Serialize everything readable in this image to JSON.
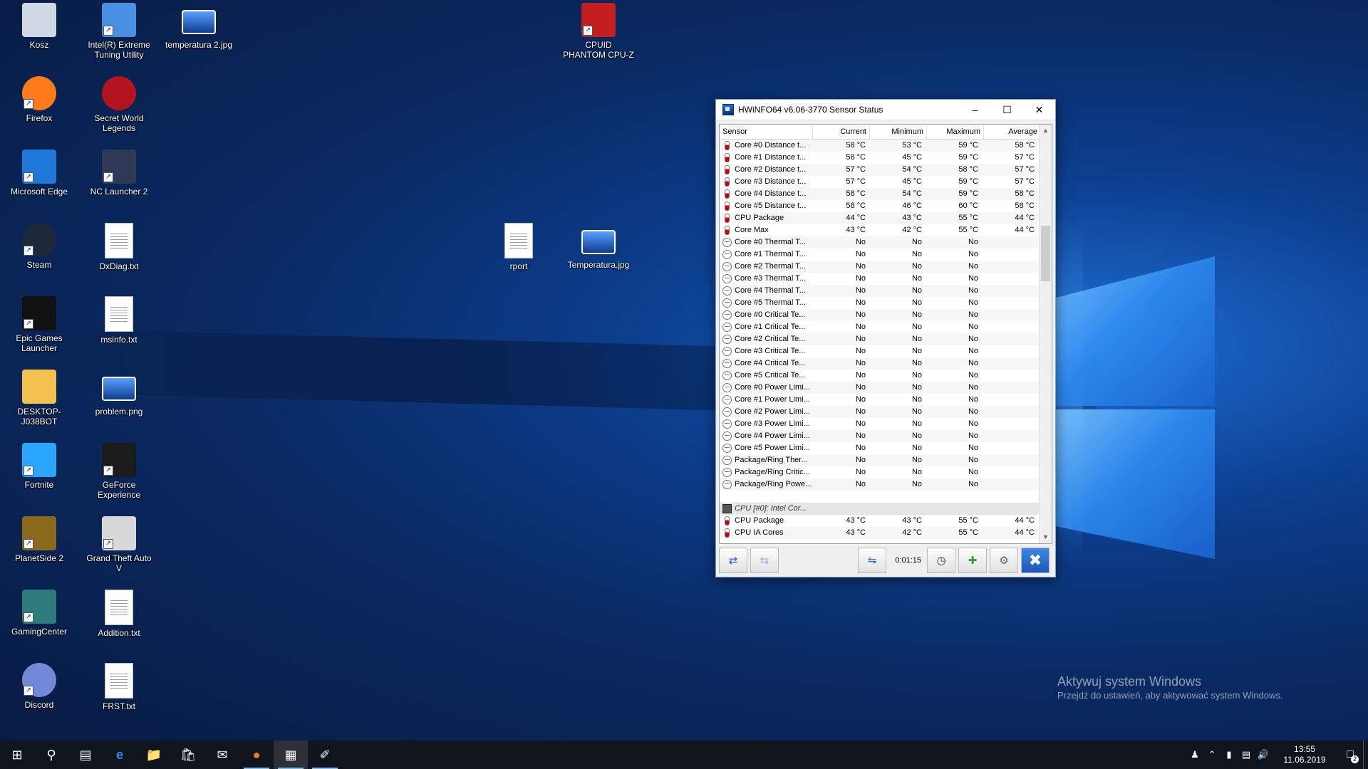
{
  "desktop": {
    "icons": [
      {
        "label": "Kosz",
        "icon": "recycle-bin-icon",
        "color": "#cfd8e3"
      },
      {
        "label": "Intel(R) Extreme Tuning Utility",
        "icon": "intel-xtu-icon",
        "color": "#4a90e2"
      },
      {
        "label": "temperatura 2.jpg",
        "icon": "image-file-icon",
        "color": "#2f7bd8"
      },
      {
        "label": "CPUID PHANTOM CPU-Z",
        "icon": "cpuz-icon",
        "color": "#c41f1f"
      },
      {
        "label": "Firefox",
        "icon": "firefox-icon",
        "color": "#ff7a1a"
      },
      {
        "label": "Secret World Legends",
        "icon": "secret-world-icon",
        "color": "#b3131f"
      },
      {
        "label": "Microsoft Edge",
        "icon": "edge-icon",
        "color": "#1e78d7"
      },
      {
        "label": "NC Launcher 2",
        "icon": "nc-launcher-icon",
        "color": "#2e3a55"
      },
      {
        "label": "Steam",
        "icon": "steam-icon",
        "color": "#1b2838"
      },
      {
        "label": "DxDiag.txt",
        "icon": "text-file-icon",
        "color": "#ffffff"
      },
      {
        "label": "rport",
        "icon": "file-icon",
        "color": "#ffffff"
      },
      {
        "label": "Temperatura.jpg",
        "icon": "image-file-icon",
        "color": "#2f7bd8"
      },
      {
        "label": "Epic Games Launcher",
        "icon": "epic-games-icon",
        "color": "#111111"
      },
      {
        "label": "msinfo.txt",
        "icon": "text-file-icon",
        "color": "#ffffff"
      },
      {
        "label": "DESKTOP-J038BOT",
        "icon": "folder-icon",
        "color": "#f2c14e"
      },
      {
        "label": "problem.png",
        "icon": "image-file-icon",
        "color": "#2f7bd8"
      },
      {
        "label": "Fortnite",
        "icon": "fortnite-icon",
        "color": "#2aa6ff"
      },
      {
        "label": "GeForce Experience",
        "icon": "geforce-icon",
        "color": "#1b1b1b"
      },
      {
        "label": "PlanetSide 2",
        "icon": "planetside-icon",
        "color": "#8a6a1a"
      },
      {
        "label": "Grand Theft Auto V",
        "icon": "gta-icon",
        "color": "#d8d8d8"
      },
      {
        "label": "GamingCenter",
        "icon": "gaming-center-icon",
        "color": "#2d7b7b"
      },
      {
        "label": "Addition.txt",
        "icon": "text-file-icon",
        "color": "#ffffff"
      },
      {
        "label": "Discord",
        "icon": "discord-icon",
        "color": "#7289da"
      },
      {
        "label": "FRST.txt",
        "icon": "text-file-icon",
        "color": "#ffffff"
      }
    ]
  },
  "hwinfo": {
    "title": "HWiNFO64 v6.06-3770 Sensor Status",
    "columns": [
      "Sensor",
      "Current",
      "Minimum",
      "Maximum",
      "Average"
    ],
    "rows": [
      {
        "type": "temp",
        "sensor": "Core #0 Distance t...",
        "current": "58 °C",
        "minimum": "53 °C",
        "maximum": "59 °C",
        "average": "58 °C"
      },
      {
        "type": "temp",
        "sensor": "Core #1 Distance t...",
        "current": "58 °C",
        "minimum": "45 °C",
        "maximum": "59 °C",
        "average": "57 °C"
      },
      {
        "type": "temp",
        "sensor": "Core #2 Distance t...",
        "current": "57 °C",
        "minimum": "54 °C",
        "maximum": "58 °C",
        "average": "57 °C"
      },
      {
        "type": "temp",
        "sensor": "Core #3 Distance t...",
        "current": "57 °C",
        "minimum": "45 °C",
        "maximum": "59 °C",
        "average": "57 °C"
      },
      {
        "type": "temp",
        "sensor": "Core #4 Distance t...",
        "current": "58 °C",
        "minimum": "54 °C",
        "maximum": "59 °C",
        "average": "58 °C"
      },
      {
        "type": "temp",
        "sensor": "Core #5 Distance t...",
        "current": "58 °C",
        "minimum": "46 °C",
        "maximum": "60 °C",
        "average": "58 °C"
      },
      {
        "type": "temp",
        "sensor": "CPU Package",
        "current": "44 °C",
        "minimum": "43 °C",
        "maximum": "55 °C",
        "average": "44 °C"
      },
      {
        "type": "temp",
        "sensor": "Core Max",
        "current": "43 °C",
        "minimum": "42 °C",
        "maximum": "55 °C",
        "average": "44 °C"
      },
      {
        "type": "flag",
        "sensor": "Core #0 Thermal T...",
        "current": "No",
        "minimum": "No",
        "maximum": "No",
        "average": ""
      },
      {
        "type": "flag",
        "sensor": "Core #1 Thermal T...",
        "current": "No",
        "minimum": "No",
        "maximum": "No",
        "average": ""
      },
      {
        "type": "flag",
        "sensor": "Core #2 Thermal T...",
        "current": "No",
        "minimum": "No",
        "maximum": "No",
        "average": ""
      },
      {
        "type": "flag",
        "sensor": "Core #3 Thermal T...",
        "current": "No",
        "minimum": "No",
        "maximum": "No",
        "average": ""
      },
      {
        "type": "flag",
        "sensor": "Core #4 Thermal T...",
        "current": "No",
        "minimum": "No",
        "maximum": "No",
        "average": ""
      },
      {
        "type": "flag",
        "sensor": "Core #5 Thermal T...",
        "current": "No",
        "minimum": "No",
        "maximum": "No",
        "average": ""
      },
      {
        "type": "flag",
        "sensor": "Core #0 Critical Te...",
        "current": "No",
        "minimum": "No",
        "maximum": "No",
        "average": ""
      },
      {
        "type": "flag",
        "sensor": "Core #1 Critical Te...",
        "current": "No",
        "minimum": "No",
        "maximum": "No",
        "average": ""
      },
      {
        "type": "flag",
        "sensor": "Core #2 Critical Te...",
        "current": "No",
        "minimum": "No",
        "maximum": "No",
        "average": ""
      },
      {
        "type": "flag",
        "sensor": "Core #3 Critical Te...",
        "current": "No",
        "minimum": "No",
        "maximum": "No",
        "average": ""
      },
      {
        "type": "flag",
        "sensor": "Core #4 Critical Te...",
        "current": "No",
        "minimum": "No",
        "maximum": "No",
        "average": ""
      },
      {
        "type": "flag",
        "sensor": "Core #5 Critical Te...",
        "current": "No",
        "minimum": "No",
        "maximum": "No",
        "average": ""
      },
      {
        "type": "flag",
        "sensor": "Core #0 Power Limi...",
        "current": "No",
        "minimum": "No",
        "maximum": "No",
        "average": ""
      },
      {
        "type": "flag",
        "sensor": "Core #1 Power Limi...",
        "current": "No",
        "minimum": "No",
        "maximum": "No",
        "average": ""
      },
      {
        "type": "flag",
        "sensor": "Core #2 Power Limi...",
        "current": "No",
        "minimum": "No",
        "maximum": "No",
        "average": ""
      },
      {
        "type": "flag",
        "sensor": "Core #3 Power Limi...",
        "current": "No",
        "minimum": "No",
        "maximum": "No",
        "average": ""
      },
      {
        "type": "flag",
        "sensor": "Core #4 Power Limi...",
        "current": "No",
        "minimum": "No",
        "maximum": "No",
        "average": ""
      },
      {
        "type": "flag",
        "sensor": "Core #5 Power Limi...",
        "current": "No",
        "minimum": "No",
        "maximum": "No",
        "average": ""
      },
      {
        "type": "flag",
        "sensor": "Package/Ring Ther...",
        "current": "No",
        "minimum": "No",
        "maximum": "No",
        "average": ""
      },
      {
        "type": "flag",
        "sensor": "Package/Ring Critic...",
        "current": "No",
        "minimum": "No",
        "maximum": "No",
        "average": ""
      },
      {
        "type": "flag",
        "sensor": "Package/Ring Powe...",
        "current": "No",
        "minimum": "No",
        "maximum": "No",
        "average": ""
      },
      {
        "type": "blank",
        "sensor": "",
        "current": "",
        "minimum": "",
        "maximum": "",
        "average": ""
      },
      {
        "type": "group",
        "sensor": "CPU [#0]: Intel Cor...",
        "current": "",
        "minimum": "",
        "maximum": "",
        "average": ""
      },
      {
        "type": "temp",
        "sensor": "CPU Package",
        "current": "43 °C",
        "minimum": "43 °C",
        "maximum": "55 °C",
        "average": "44 °C"
      },
      {
        "type": "temp",
        "sensor": "CPU IA Cores",
        "current": "43 °C",
        "minimum": "42 °C",
        "maximum": "55 °C",
        "average": "44 °C"
      }
    ],
    "toolbar": {
      "elapsed": "0:01:15",
      "buttons": [
        "nav-arrows-icon",
        "nav-arrows-dim-icon",
        "network-icon",
        "clock-icon",
        "add-report-icon",
        "settings-icon",
        "close-icon"
      ]
    }
  },
  "activation": {
    "line1": "Aktywuj system Windows",
    "line2": "Przejdź do ustawień, aby aktywować system Windows."
  },
  "taskbar": {
    "apps": [
      "windows-start-icon",
      "search-icon",
      "task-view-icon",
      "edge-icon",
      "file-explorer-icon",
      "store-icon",
      "mail-icon",
      "firefox-icon",
      "hwinfo-icon",
      "paint-icon"
    ],
    "clock_time": "13:55",
    "clock_date": "11.06.2019",
    "notification_count": "2"
  }
}
